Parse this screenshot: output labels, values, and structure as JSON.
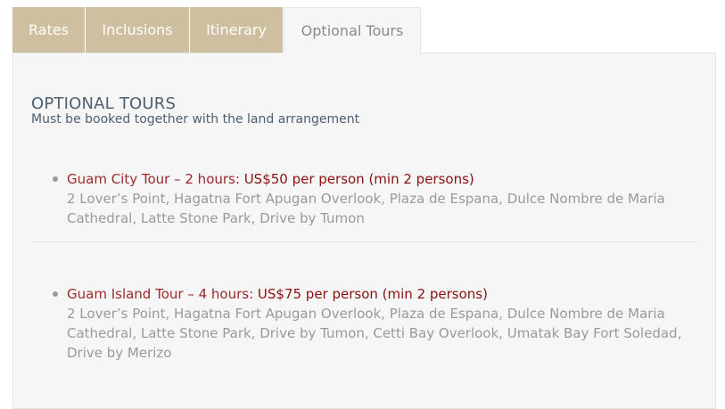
{
  "tabs": [
    {
      "label": "Rates"
    },
    {
      "label": "Inclusions"
    },
    {
      "label": "Itinerary"
    },
    {
      "label": "Optional Tours"
    }
  ],
  "section": {
    "title": "OPTIONAL TOURS",
    "subtitle": "Must be booked together with the land arrangement"
  },
  "tours": [
    {
      "name": "Guam City Tour – 2 hours: ",
      "price": "US$50 per person (min 2 persons)",
      "description": "2 Lover’s Point, Hagatna Fort Apugan Overlook, Plaza de Espana, Dulce Nombre de Maria Cathedral, Latte Stone Park, Drive by Tumon"
    },
    {
      "name": "Guam Island Tour – 4 hours: ",
      "price": "US$75 per person (min 2 persons)",
      "description": "2 Lover’s Point, Hagatna Fort Apugan Overlook, Plaza de Espana, Dulce Nombre de Maria Cathedral, Latte Stone Park, Drive by Tumon, Cetti Bay Overlook, Umatak Bay Fort Soledad, Drive by Merizo"
    }
  ],
  "colors": {
    "tab_bg": "#cdbf9f",
    "panel_bg": "#f6f6f6",
    "title": "#4d5f72",
    "tour_name": "#9b2a2a",
    "tour_price": "#8b0f0f",
    "description": "#9a9a9a"
  }
}
